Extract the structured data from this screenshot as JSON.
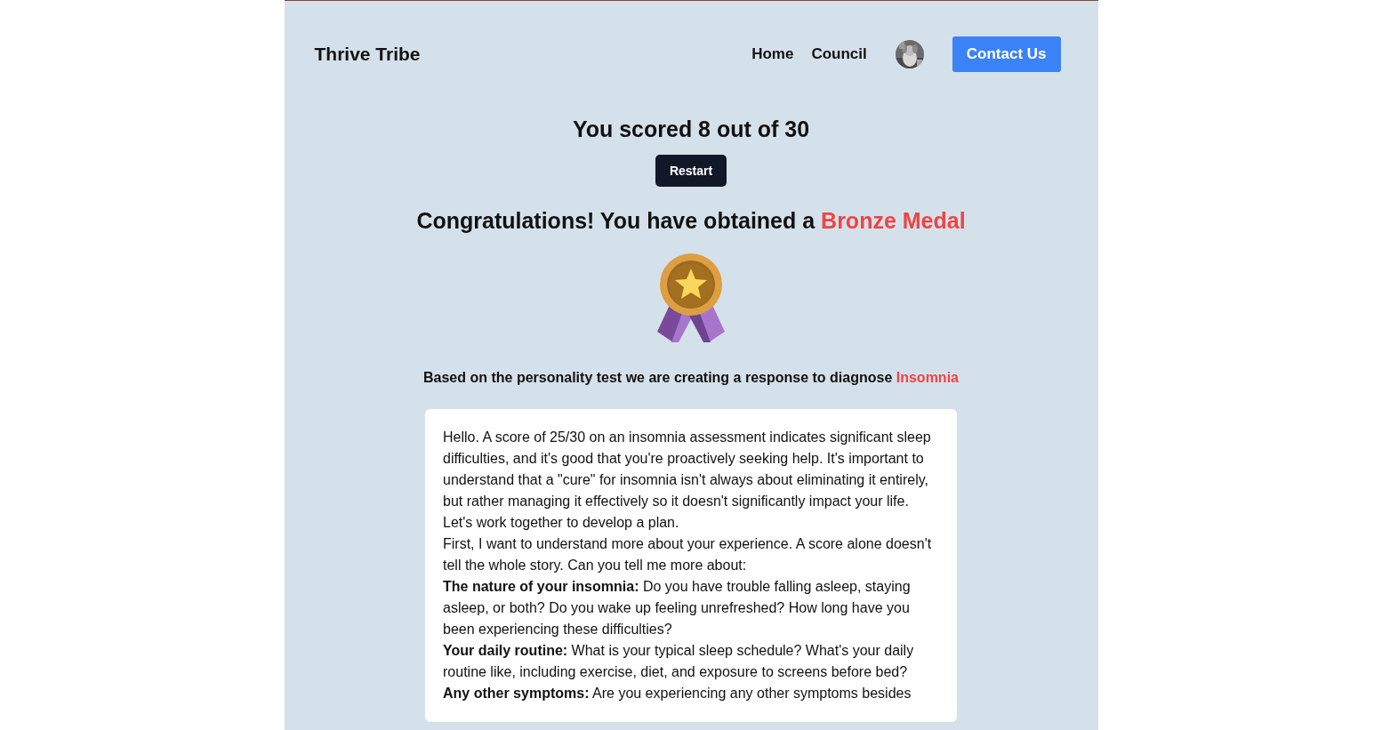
{
  "header": {
    "brand": "Thrive Tribe",
    "nav": [
      {
        "label": "Home"
      },
      {
        "label": "Council"
      }
    ],
    "contact_button": "Contact Us"
  },
  "score": {
    "text": "You scored 8 out of 30",
    "restart_button": "Restart"
  },
  "award": {
    "prefix": "Congratulations! You have obtained a ",
    "medal": "Bronze Medal"
  },
  "diagnosis": {
    "prefix": "Based on the personality test we are creating a response to diagnose ",
    "condition": "Insomnia"
  },
  "response": {
    "paragraphs": [
      "Hello. A score of 25/30 on an insomnia assessment indicates significant sleep difficulties, and it's good that you're proactively seeking help. It's important to understand that a \"cure\" for insomnia isn't always about eliminating it entirely, but rather managing it effectively so it doesn't significantly impact your life. Let's work together to develop a plan.",
      "First, I want to understand more about your experience. A score alone doesn't tell the whole story. Can you tell me more about:",
      "**The nature of your insomnia:** Do you have trouble falling asleep, staying asleep, or both? Do you wake up feeling unrefreshed? How long have you been experiencing these difficulties?",
      "**Your daily routine:** What is your typical sleep schedule? What's your daily routine like, including exercise, diet, and exposure to screens before bed?",
      "**Any other symptoms:** Are you experiencing any other symptoms besides"
    ]
  }
}
